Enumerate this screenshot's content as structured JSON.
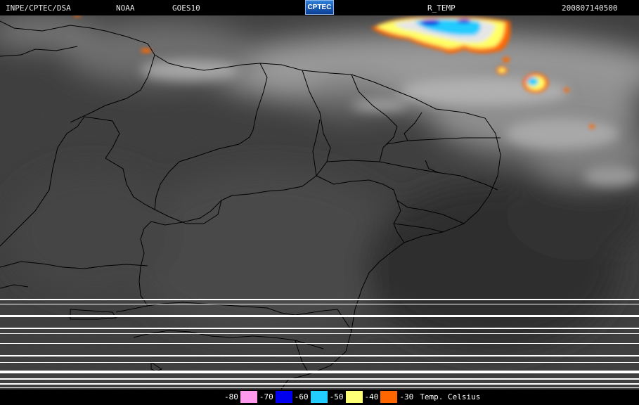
{
  "header": {
    "source": "INPE/CPTEC/DSA",
    "agency": "NOAA",
    "satellite": "GOES10",
    "logo_text": "CPTEC",
    "product": "R_TEMP",
    "timestamp": "200807140500"
  },
  "legend": {
    "title": "Temp. Celsius",
    "items": [
      {
        "label": "-80",
        "color": "#ff99ee"
      },
      {
        "label": "-70",
        "color": "#0000ee"
      },
      {
        "label": "-60",
        "color": "#22ccff"
      },
      {
        "label": "-50",
        "color": "#ffff77"
      },
      {
        "label": "-40",
        "color": "#ff6600"
      },
      {
        "label": "-30",
        "color": "#000000"
      }
    ]
  }
}
